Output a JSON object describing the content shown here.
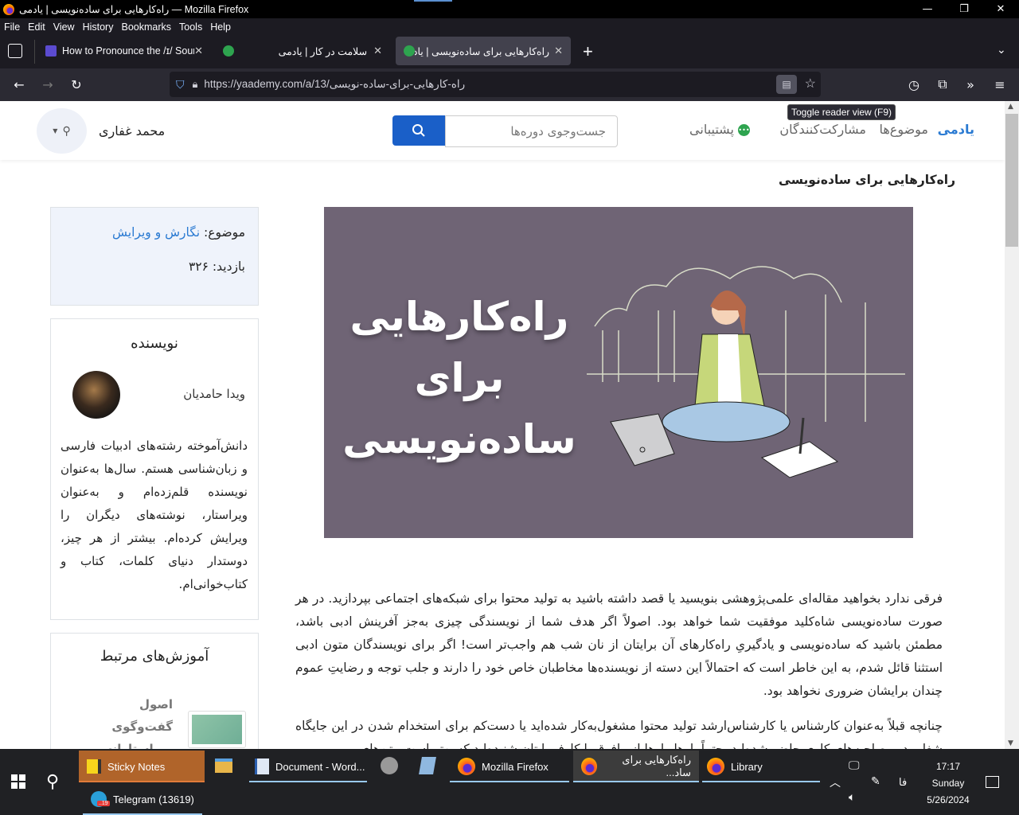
{
  "window": {
    "title": "راه‌کارهایی برای ساده‌نویسی | یادمی — Mozilla Firefox",
    "minimize": "—",
    "restore": "❐",
    "close": "✕"
  },
  "menu": [
    "File",
    "Edit",
    "View",
    "History",
    "Bookmarks",
    "Tools",
    "Help"
  ],
  "tabs": [
    {
      "title": "How to Pronounce the /ɪ/ Soun",
      "active": false
    },
    {
      "title": "",
      "active": false
    },
    {
      "title": "سلامت در کار | یادمی",
      "active": false
    },
    {
      "title": "راه‌کارهایی برای ساده‌نویسی | یادمی",
      "active": true
    }
  ],
  "tab_close": "✕",
  "new_tab": "+",
  "url": "https://yaademy.com/a/13/راه-کارهایی-برای-ساده-نویسی",
  "tooltip": "Toggle reader view (F9)",
  "site": {
    "brand": "یادمی",
    "nav": [
      "موضوع‌ها",
      "مشارکت‌کنندگان",
      "پشتیبانی"
    ],
    "search_placeholder": "جست‌وجوی دوره‌ها",
    "username": "محمد غفاری"
  },
  "article": {
    "title": "راه‌کارهایی برای ساده‌نویسی",
    "hero_lines": [
      "راه‌کارهایی",
      "برای",
      "ساده‌نویسی"
    ],
    "paragraphs": [
      "فرقی ندارد بخواهید مقاله‌ای علمی‌پژوهشی بنویسید یا قصد داشته باشید به تولید محتوا برای شبکه‌های اجتماعی بپردازید. در هر صورت ساده‌نویسی شاه‌کلید موفقیت شما خواهد بود. اصولاً اگر هدف شما از نویسندگی چیزی به‌جز آفرینش ادبی باشد، مطمئن باشید که ساده‌نویسی و یادگیریِ راه‌کارهای آن برایتان از نان شب هم واجب‌تر است! اگر برای نویسندگان متون ادبی استثنا قائل شدم، به این خاطر است که احتمالاً این دسته از نویسنده‌ها مخاطبان خاص خود را دارند و جلب توجه و رضایتِ عموم چندان برایشان ضروری نخواهد بود.",
      "چنانچه قبلاً به‌عنوان کارشناس یا کارشناس‌ارشد تولید محتوا مشغول‌به‌کار شده‌اید یا دست‌کم برای استخدام شدن در این جایگاه شغلی در مصاحبه‌های کاری حاضر شده‌اید، حتماً بارها‌وبارها از مافوق یا کارفرمایتان شنیده‌اید که بهتر است متن‌های"
    ]
  },
  "sidebar": {
    "topic_label": "موضوع:",
    "topic_value": "نگارش و ویرایش",
    "views_label": "بازدید:",
    "views_value": "۳۲۶",
    "author_heading": "نویسنده",
    "author_name": "ویدا حامدیان",
    "author_bio": "دانش‌آموخته رشته‌های ادبیات فارسی و زبان‌شناسی هستم. سال‌ها به‌عنوان نویسنده قلم‌زده‌ام و به‌عنوان ویراستار، نوشته‌های دیگران را ویرایش کرده‌ام. بیشتر از هر چیز، دوستدار دنیای کلمات، کتاب و کتاب‌خوانی‌ام.",
    "related_heading": "آموزش‌های مرتبط",
    "related_items": [
      {
        "title": "اصول گفت‌وگوی ویراستارانه"
      }
    ]
  },
  "taskbar": {
    "items": [
      "Sticky Notes",
      "Telegram (13619)",
      "Document - Word...",
      "Mozilla Firefox",
      "راه‌کارهایی برای ساد...",
      "Library"
    ],
    "telegram_badge": "..19",
    "ime": "فا",
    "time": "17:17",
    "day": "Sunday",
    "date": "5/26/2024"
  },
  "colors": {
    "accent": "#1a5fc8",
    "link": "#2a7ad2",
    "hero_bg": "#6f6475",
    "info_box_bg": "#eff3fb",
    "sticky_notes": "#b0642a"
  }
}
